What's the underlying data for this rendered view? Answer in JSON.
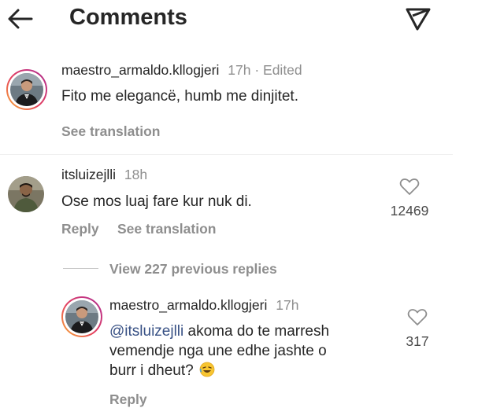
{
  "header": {
    "title": "Comments"
  },
  "caption": {
    "username": "maestro_armaldo.kllogjeri",
    "time": "17h",
    "separator": "·",
    "edited": "Edited",
    "text": "Fito me elegancë, humb me dinjitet.",
    "see_translation": "See translation"
  },
  "comment": {
    "username": "itsluizejlli",
    "time": "18h",
    "text": "Ose mos luaj fare kur nuk di.",
    "reply_label": "Reply",
    "see_translation": "See translation",
    "likes": "12469"
  },
  "view_replies": {
    "label": "View 227 previous replies"
  },
  "reply": {
    "username": "maestro_armaldo.kllogjeri",
    "time": "17h",
    "mention": "@itsluizejlli",
    "text_line1": " akoma do te marresh",
    "text_line2": "vemendje nga une edhe jashte o",
    "text_line3": "burr i dheut?",
    "reply_label": "Reply",
    "likes": "317"
  },
  "icons": {
    "back": "arrow-left-icon",
    "send": "paper-plane-icon",
    "like": "heart-outline-icon",
    "emoji": "rolling-laughing-emoji"
  },
  "colors": {
    "text": "#262626",
    "secondary": "#8e8e8e",
    "mention": "#385185",
    "story_ring_start": "#f9b233",
    "story_ring_end": "#c13584"
  }
}
